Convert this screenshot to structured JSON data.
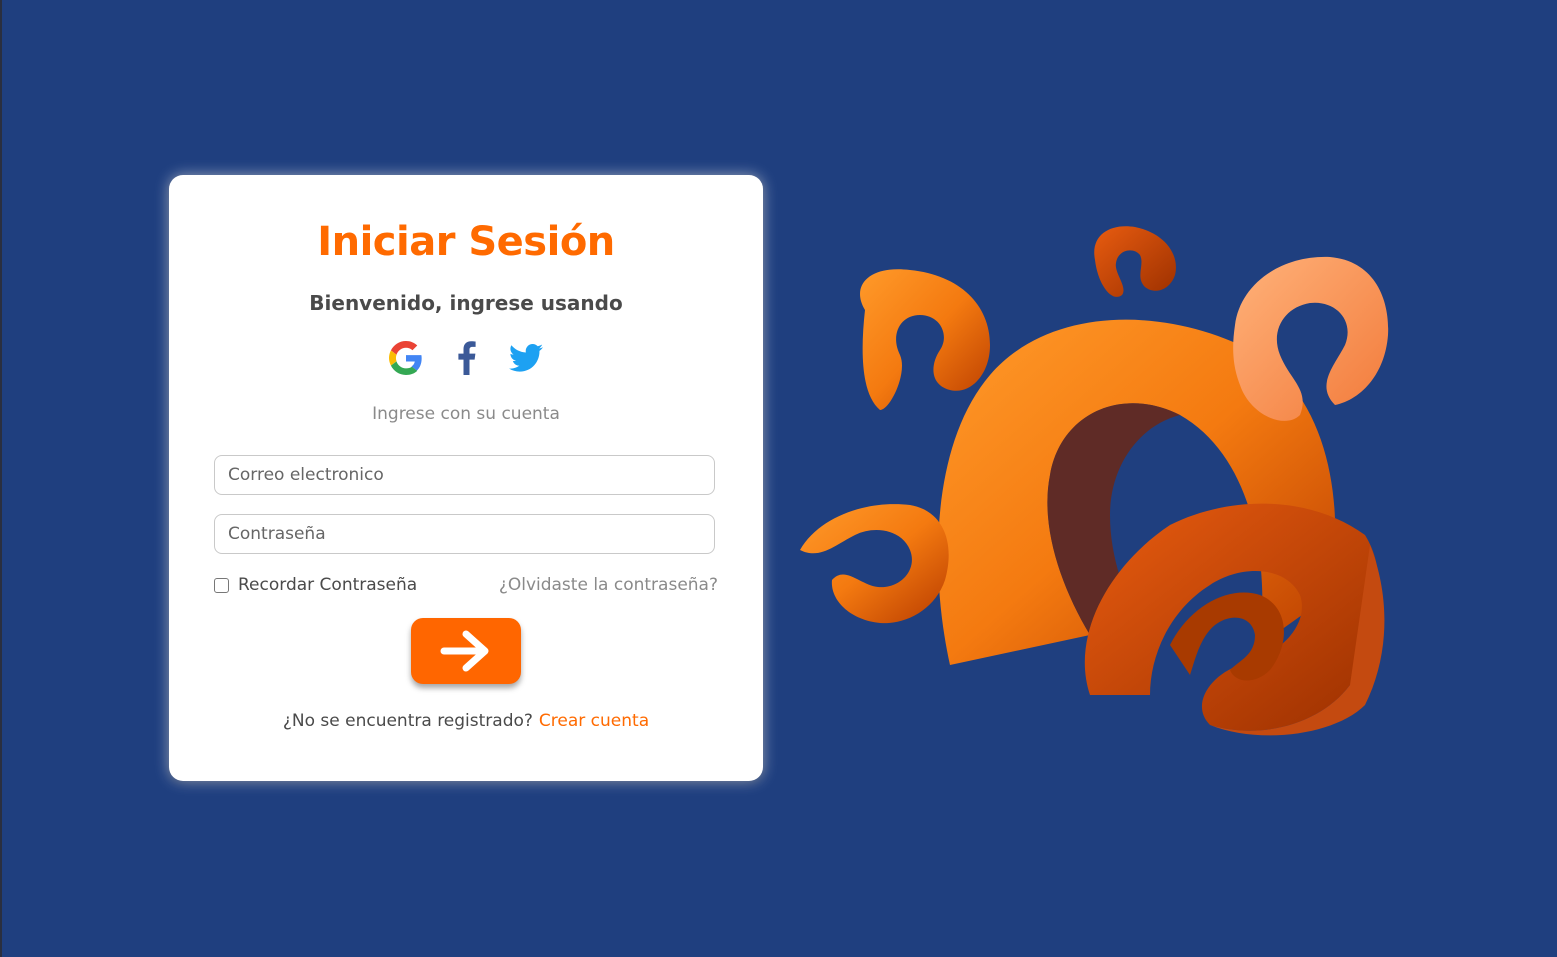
{
  "login": {
    "title": "Iniciar Sesión",
    "subtitle": "Bienvenido, ingrese usando",
    "social": [
      "google-icon",
      "facebook-icon",
      "twitter-icon"
    ],
    "hint": "Ingrese con su cuenta",
    "email_placeholder": "Correo electronico",
    "password_placeholder": "Contraseña",
    "remember_label": "Recordar Contraseña",
    "forgot_label": "¿Olvidaste la contraseña?",
    "register_text": "¿No se encuentra registrado?",
    "register_link": "Crear cuenta"
  },
  "colors": {
    "background": "#1f3f7f",
    "accent": "#ff6a00",
    "card": "#ffffff"
  }
}
